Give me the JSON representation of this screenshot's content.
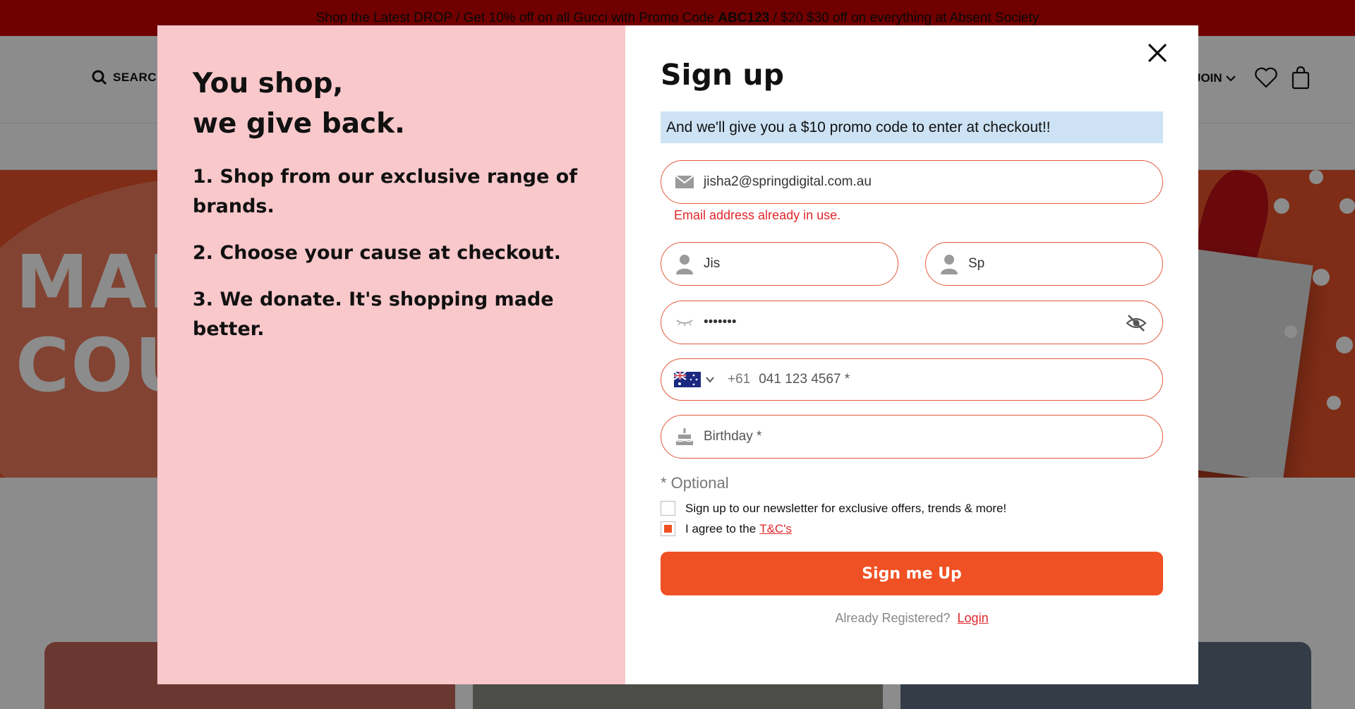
{
  "promo_bar": {
    "text_before": "Shop the Latest DROP / Get 10% off on all Gucci with Promo Code ",
    "code": "ABC123",
    "text_after": " / $20 $30 off on everything at Absent Society"
  },
  "header": {
    "search_label": "SEARCH",
    "join_label": "JOIN"
  },
  "hero": {
    "line1": "MAK",
    "line2": "COU"
  },
  "modal": {
    "tagline_line1": "You shop,",
    "tagline_line2": "we give back.",
    "steps": [
      "1. Shop from our exclusive range of brands.",
      "2. Choose your cause at checkout.",
      "3. We donate. It's shopping made better."
    ],
    "title": "Sign up",
    "promo_note": "And we'll give you a $10 promo code to enter at checkout!!",
    "email_value": "jisha2@springdigital.com.au",
    "email_error": "Email address already in use.",
    "first_name_value": "Jis",
    "last_name_value": "Sp",
    "password_mask": "•••••••",
    "phone_country_code": "+61",
    "phone_placeholder": "041 123 4567 *",
    "birthday_placeholder": "Birthday *",
    "optional_note": "* Optional",
    "newsletter_label": "Sign up to our newsletter for exclusive offers, trends & more!",
    "terms_label": "I agree to the",
    "terms_link": "T&C's",
    "submit_label": "Sign me Up",
    "already_registered": "Already Registered?",
    "login_link": "Login",
    "close_icon_glyph": "✕"
  },
  "colors": {
    "accent": "#f05124",
    "error": "#e1262a",
    "field_border": "#e45a3c",
    "promo_bar": "#cc0000",
    "left_panel": "#f9c8cb",
    "note_bg": "#cde3f5"
  }
}
